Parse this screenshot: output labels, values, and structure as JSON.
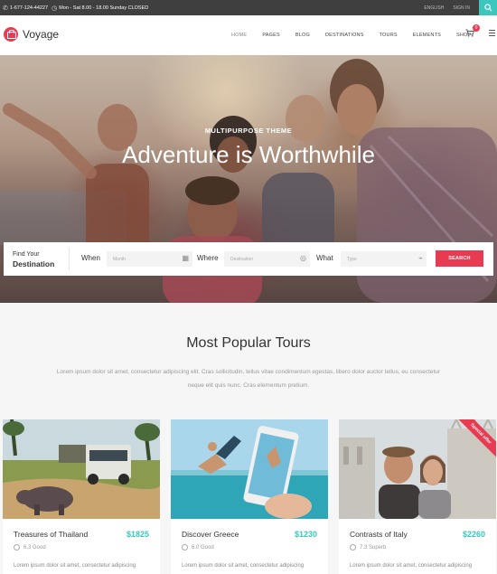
{
  "topbar": {
    "phone": "1-677-124-44227",
    "hours": "Mon - Sat 8.00 - 18.00 Sunday CLOSED",
    "language": "ENGLISH",
    "sign_in": "SIGN IN"
  },
  "header": {
    "logo_text": "Voyage",
    "nav": [
      "HOME",
      "PAGES",
      "BLOG",
      "DESTINATIONS",
      "TOURS",
      "ELEMENTS",
      "SHOP"
    ],
    "cart_count": "0"
  },
  "hero": {
    "subtitle": "MULTIPURPOSE THEME",
    "title": "Adventure is Worthwhile"
  },
  "search": {
    "find_line1": "Find Your",
    "find_line2": "Destination",
    "when_label": "When",
    "when_placeholder": "Month",
    "where_label": "Where",
    "where_placeholder": "Destination",
    "what_label": "What",
    "what_placeholder": "Type",
    "button_label": "SEARCH"
  },
  "section": {
    "title": "Most Popular Tours",
    "description": "Lorem ipsum dolor sit amet, consectetur adipiscing elit. Cras sollicitudin, tellus vitae condimentum egestas, libero dolor auctor tellus, eu consectetur neque elit quis nunc. Cras elementum pretium."
  },
  "tours": [
    {
      "name": "Treasures of Thailand",
      "price": "$1825",
      "rating": "6.3 Good",
      "desc": "Lorem ipsum dolor sit amet, consectetur adipiscing"
    },
    {
      "name": "Discover Greece",
      "price": "$1230",
      "rating": "6.0 Good",
      "desc": "Lorem ipsum dolor sit amet, consectetur adipiscing"
    },
    {
      "name": "Contrasts of Italy",
      "price": "$2260",
      "rating": "7.3 Superb",
      "desc": "Lorem ipsum dolor sit amet, consectetur adipiscing",
      "ribbon": "Special offer"
    }
  ],
  "colors": {
    "accent": "#3cc7be",
    "brand": "#e83b52",
    "topbar": "#3f3f3f"
  },
  "icons": [
    "phone-icon",
    "clock-icon",
    "search-icon",
    "cart-icon",
    "menu-icon",
    "calendar-icon",
    "compass-icon",
    "tag-icon",
    "rating-icon"
  ]
}
